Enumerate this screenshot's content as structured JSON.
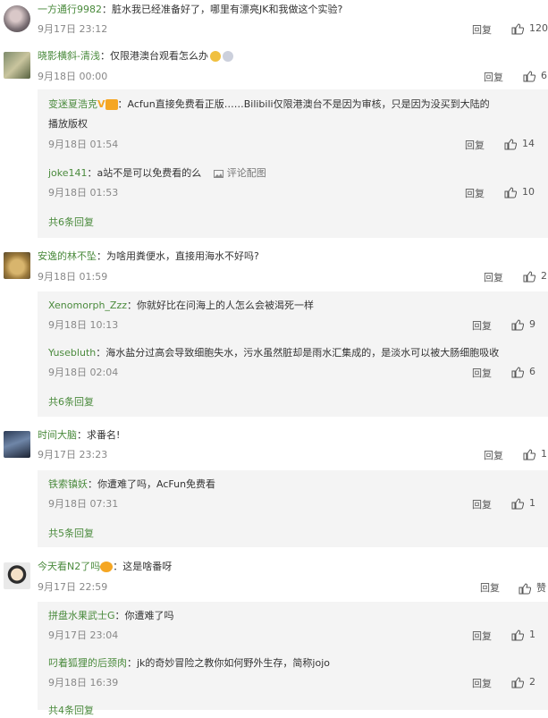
{
  "comments": [
    {
      "name": "一方通行9982",
      "text": "：脏水我已经准备好了，哪里有漂亮JK和我做这个实验?",
      "time": "9月17日 23:12",
      "reply_label": "回复",
      "likes": "120"
    },
    {
      "name": "晓影横斜-清浅",
      "text": "：仅限港澳台观看怎么办",
      "time": "9月18日 00:00",
      "reply_label": "回复",
      "likes": "6",
      "replies": [
        {
          "name": "变迷夏浩克",
          "text": "：Acfun直接免费看正版……Bilibili仅限港澳台不是因为审核，只是因为没买到大陆的",
          "text2": "播放版权",
          "time": "9月18日 01:54",
          "reply_label": "回复",
          "likes": "14"
        },
        {
          "name": "joke141",
          "text": "：a站不是可以免费看的么",
          "pic_label": "评论配图",
          "time": "9月18日 01:53",
          "reply_label": "回复",
          "likes": "10"
        }
      ],
      "more": "共6条回复"
    },
    {
      "name": "安逸的林不坠",
      "text": "：为啥用粪便水，直接用海水不好吗?",
      "time": "9月18日 01:59",
      "reply_label": "回复",
      "likes": "2",
      "replies": [
        {
          "name": "Xenomorph_Zzz",
          "text": "：你就好比在问海上的人怎么会被渴死一样",
          "time": "9月18日 10:13",
          "reply_label": "回复",
          "likes": "9"
        },
        {
          "name": "Yusebluth",
          "text": "：海水盐分过高会导致细胞失水，污水虽然脏却是雨水汇集成的，是淡水可以被大肠细胞吸收",
          "time": "9月18日 02:04",
          "reply_label": "回复",
          "likes": "6"
        }
      ],
      "more": "共6条回复"
    },
    {
      "name": "时间大脑",
      "text": "：求番名!",
      "time": "9月17日 23:23",
      "reply_label": "回复",
      "likes": "1",
      "replies": [
        {
          "name": "铁索镇妖",
          "text": "：你遭难了吗，AcFun免费看",
          "time": "9月18日 07:31",
          "reply_label": "回复",
          "likes": "1"
        }
      ],
      "more": "共5条回复"
    },
    {
      "name": "今天看N2了吗",
      "text": "：这是啥番呀",
      "time": "9月17日 22:59",
      "reply_label": "回复",
      "likes": "赞",
      "replies": [
        {
          "name": "拼盘水果武士G",
          "text": "：你遭难了吗",
          "time": "9月17日 23:04",
          "reply_label": "回复",
          "likes": "1"
        },
        {
          "name": "叼着狐狸的后颈肉",
          "text": "：jk的奇妙冒险之教你如何野外生存，简称jojo",
          "time": "9月18日 16:39",
          "reply_label": "回复",
          "likes": "2"
        }
      ],
      "more": "共4条回复"
    }
  ],
  "colors": {
    "name": "#4a8a3c",
    "reply_bg": "#f4f4f4",
    "vip": "#f5a623"
  }
}
